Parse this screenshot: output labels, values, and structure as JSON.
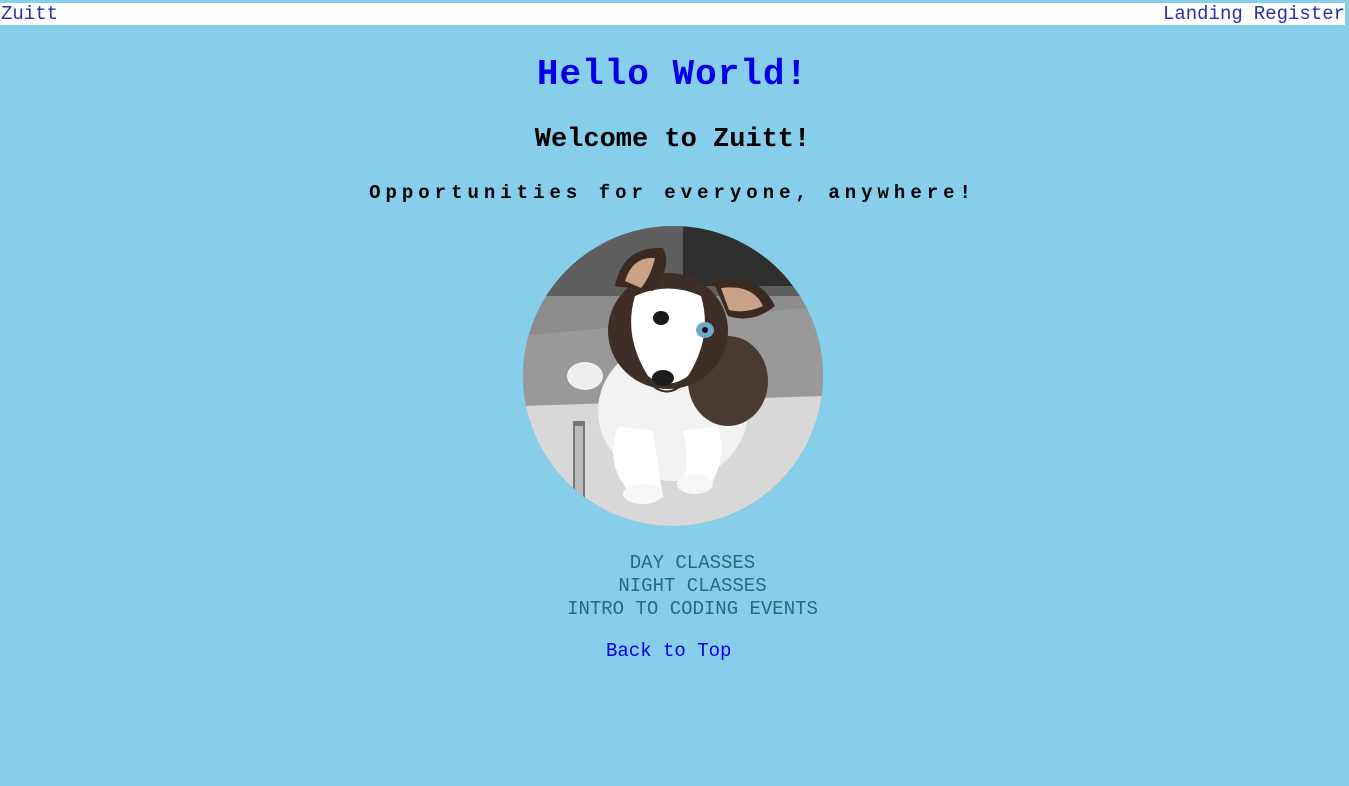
{
  "navbar": {
    "brand": "Zuitt",
    "links": [
      "Landing",
      "Register"
    ]
  },
  "main": {
    "title": "Hello World!",
    "welcome": "Welcome to Zuitt!",
    "tagline": "Opportunities for everyone, anywhere!",
    "photo_subject": "husky puppy lying on a rug",
    "classes": [
      "DAY CLASSES",
      "NIGHT CLASSES",
      "INTRO TO CODING EVENTS"
    ],
    "back_to_top": "Back to Top"
  },
  "colors": {
    "background": "#87ceeb",
    "navbar": "#ffffff",
    "link": "#2e2ea8",
    "title": "#0000e6",
    "list_text": "#1f6e7f"
  }
}
